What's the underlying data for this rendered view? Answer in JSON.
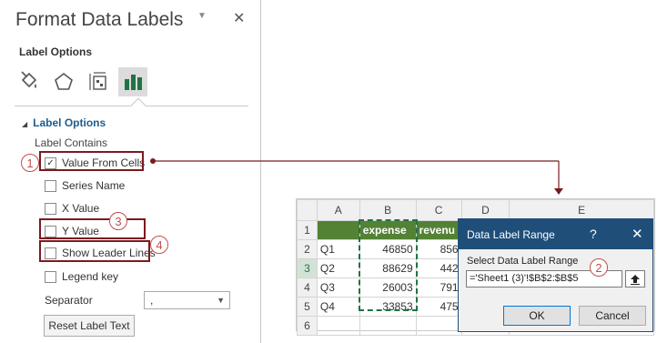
{
  "pane": {
    "title": "Format Data Labels",
    "subtitle": "Label Options",
    "icons": [
      "fill-line-icon",
      "effects-pentagon-icon",
      "size-properties-icon",
      "label-options-bar-icon"
    ],
    "section_title": "Label Options",
    "label_contains": "Label Contains",
    "options": [
      {
        "label": "Value From Cells",
        "checked": true
      },
      {
        "label": "Series Name",
        "checked": false
      },
      {
        "label": "X Value",
        "checked": false
      },
      {
        "label": "Y Value",
        "checked": false
      },
      {
        "label": "Show Leader Lines",
        "checked": false
      },
      {
        "label": "Legend key",
        "checked": false
      }
    ],
    "separator_label": "Separator",
    "separator_value": ",",
    "reset_label": "Reset Label Text"
  },
  "badges": [
    "1",
    "2",
    "3",
    "4"
  ],
  "sheet": {
    "columns": [
      "A",
      "B",
      "C",
      "D",
      "E"
    ],
    "rows": [
      {
        "num": "1",
        "a": "",
        "b": "expense",
        "c": "revenu",
        "d": "",
        "e": ""
      },
      {
        "num": "2",
        "a": "Q1",
        "b": "46850",
        "c": "856",
        "d": "",
        "e": ""
      },
      {
        "num": "3",
        "a": "Q2",
        "b": "88629",
        "c": "442",
        "d": "",
        "e": ""
      },
      {
        "num": "4",
        "a": "Q3",
        "b": "26003",
        "c": "791",
        "d": "",
        "e": ""
      },
      {
        "num": "5",
        "a": "Q4",
        "b": "33853",
        "c": "475",
        "d": "",
        "e": ""
      },
      {
        "num": "6",
        "a": "",
        "b": "",
        "c": "",
        "d": "",
        "e": ""
      }
    ]
  },
  "dialog": {
    "title": "Data Label Range",
    "help": "?",
    "close": "✕",
    "prompt": "Select Data Label Range",
    "value": "='Sheet1 (3)'!$B$2:$B$5",
    "ok": "OK",
    "cancel": "Cancel"
  },
  "colors": {
    "accent": "#1f4e79",
    "highlight_box": "#7b1a1f",
    "badge": "#c0504d",
    "header_fill": "#548235",
    "selection": "#217346"
  }
}
